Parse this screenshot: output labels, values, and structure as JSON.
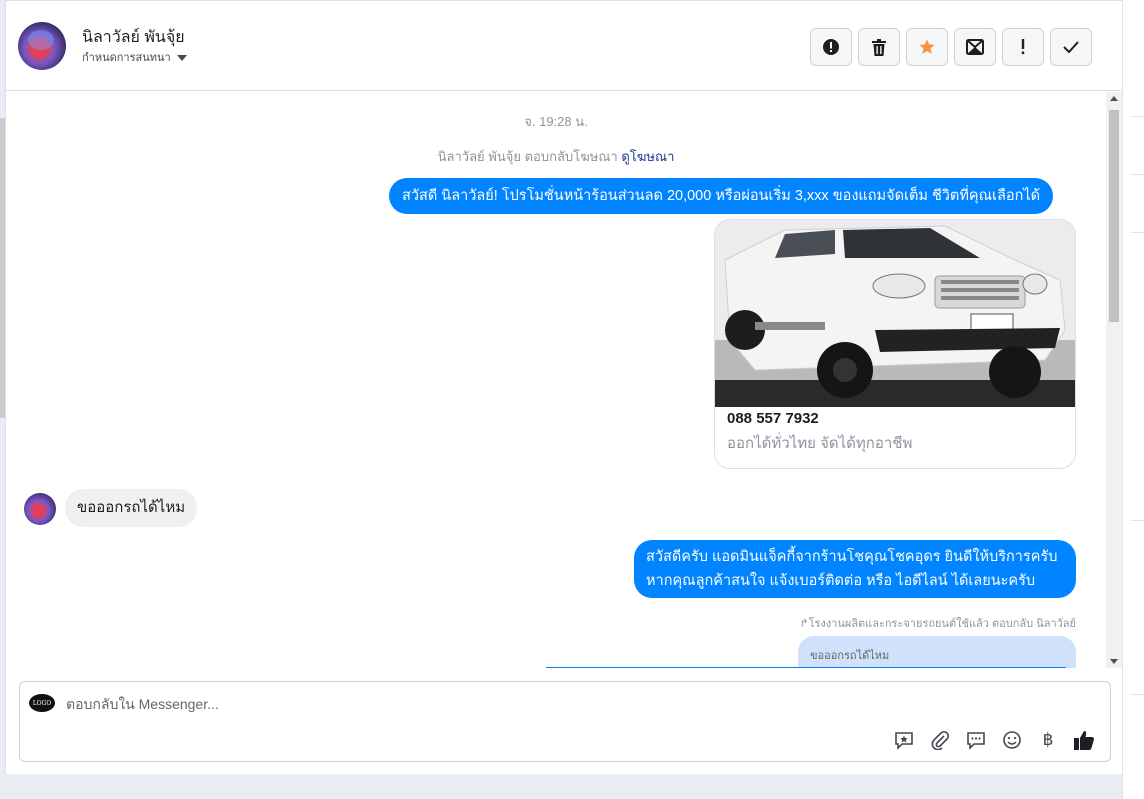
{
  "header": {
    "contact_name": "นิลาวัลย์ พันจุ้ย",
    "tag_label": "กำหนดการสนทนา",
    "actions": {
      "spam": "spam-icon",
      "delete": "trash-icon",
      "star": "star-icon",
      "mark_unread": "mark-unread-icon",
      "important": "exclamation-icon",
      "done": "check-icon"
    },
    "star_color": "#f7923b"
  },
  "conversation": {
    "timestamp": "จ. 19:28 น.",
    "reply_note_prefix": "นิลาวัลย์ พันจุ้ย ตอบกลับโฆษณา",
    "reply_note_link": "ดูโฆษณา",
    "ad_message": "สวัสดี นิลาวัลย์! โปรโมชั่นหน้าร้อนส่วนลด 20,000 หรือผ่อนเริ่ม 3,xxx ของแถมจัดเต็ม ชีวิตที่คุณเลือกได้",
    "ad_card": {
      "title": "088 557 7932",
      "subtitle": "ออกได้ทั่วไทย จัดได้ทุกอาชีพ"
    },
    "incoming_message": "ขอออกรถได้ไหม",
    "reply_lines": [
      "สวัสดีครับ แอดมินแจ็คกี้จากร้านโชคุณโชคอุดร ยินดีให้บริการครับ",
      "หากคุณลูกค้าสนใจ แจ้งเบอร์ติดต่อ หรือ ไอดีไลน์ ได้เลยนะครับ"
    ],
    "reply_meta": "โรงงานผลิตและกระจายรถยนต์ใช้แล้ว ตอบกลับ นิลาวัลย์",
    "quoted_message": "ขอออกรถได้ไหม"
  },
  "composer": {
    "placeholder": "ตอบกลับใน Messenger...",
    "page_logo_text": "LOGO",
    "tools": [
      "saved-reply-icon",
      "attachment-icon",
      "message-icon",
      "emoji-icon",
      "baht-icon",
      "thumbs-up-icon"
    ],
    "baht_symbol": "฿"
  },
  "colors": {
    "outgoing_bubble": "#0084ff",
    "incoming_bubble": "#f0f0f0",
    "quoted_bubble": "#cfe1fb"
  }
}
